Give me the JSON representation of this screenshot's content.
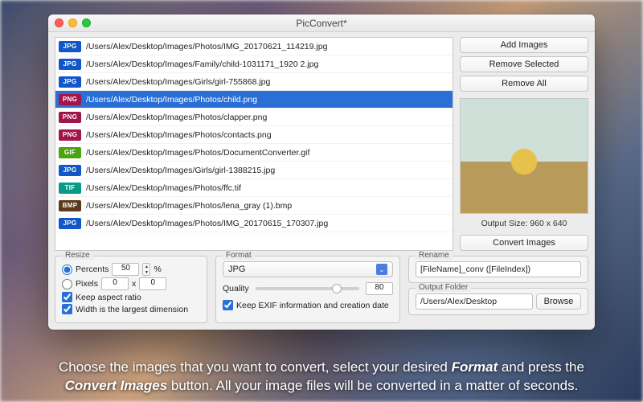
{
  "window": {
    "title": "PicConvert*"
  },
  "files": [
    {
      "type": "JPG",
      "badge": "b-jpg",
      "path": "/Users/Alex/Desktop/Images/Photos/IMG_20170621_114219.jpg",
      "selected": false
    },
    {
      "type": "JPG",
      "badge": "b-jpg",
      "path": "/Users/Alex/Desktop/Images/Family/child-1031171_1920 2.jpg",
      "selected": false
    },
    {
      "type": "JPG",
      "badge": "b-jpg",
      "path": "/Users/Alex/Desktop/Images/Girls/girl-755868.jpg",
      "selected": false
    },
    {
      "type": "PNG",
      "badge": "b-png",
      "path": "/Users/Alex/Desktop/Images/Photos/child.png",
      "selected": true
    },
    {
      "type": "PNG",
      "badge": "b-png",
      "path": "/Users/Alex/Desktop/Images/Photos/clapper.png",
      "selected": false
    },
    {
      "type": "PNG",
      "badge": "b-png",
      "path": "/Users/Alex/Desktop/Images/Photos/contacts.png",
      "selected": false
    },
    {
      "type": "GIF",
      "badge": "b-gif",
      "path": "/Users/Alex/Desktop/Images/Photos/DocumentConverter.gif",
      "selected": false
    },
    {
      "type": "JPG",
      "badge": "b-jpg",
      "path": "/Users/Alex/Desktop/Images/Girls/girl-1388215.jpg",
      "selected": false
    },
    {
      "type": "TIF",
      "badge": "b-tif",
      "path": "/Users/Alex/Desktop/Images/Photos/ffc.tif",
      "selected": false
    },
    {
      "type": "BMP",
      "badge": "b-bmp",
      "path": "/Users/Alex/Desktop/Images/Photos/lena_gray (1).bmp",
      "selected": false
    },
    {
      "type": "JPG",
      "badge": "b-jpg",
      "path": "/Users/Alex/Desktop/Images/Photos/IMG_20170615_170307.jpg",
      "selected": false
    }
  ],
  "buttons": {
    "add": "Add Images",
    "removeSel": "Remove Selected",
    "removeAll": "Remove All",
    "convert": "Convert Images",
    "browse": "Browse"
  },
  "preview": {
    "outputSize": "Output Size: 960 x 640"
  },
  "resize": {
    "legend": "Resize",
    "percentsLabel": "Percents",
    "percentsValue": "50",
    "percentSign": "%",
    "pixelsLabel": "Pixels",
    "pixW": "0",
    "pixH": "0",
    "xSep": "x",
    "keepAspect": "Keep aspect ratio",
    "widthLargest": "Width is the largest dimension"
  },
  "format": {
    "legend": "Format",
    "selected": "JPG",
    "qualityLabel": "Quality",
    "qualityValue": "80",
    "keepExif": "Keep EXIF information and creation date"
  },
  "rename": {
    "legend": "Rename",
    "pattern": "[FileName]_conv ([FileIndex])"
  },
  "outputFolder": {
    "legend": "Output Folder",
    "path": "/Users/Alex/Desktop"
  },
  "caption": {
    "pre": "Choose the images that you want to convert, select your desired ",
    "format": "Format",
    "mid": " and press the ",
    "convert": "Convert Images",
    "post": " button. All your image files will be converted in a matter of seconds."
  }
}
